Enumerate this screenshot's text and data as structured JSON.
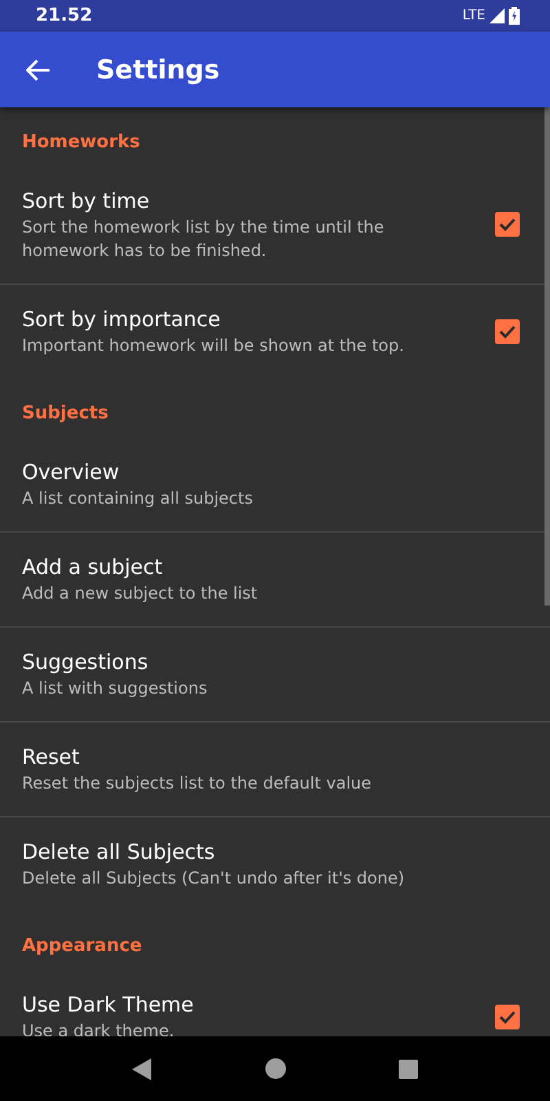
{
  "status_bar": {
    "time": "21.52",
    "network": "LTE"
  },
  "app_bar": {
    "title": "Settings"
  },
  "categories": [
    {
      "title": "Homeworks",
      "items": [
        {
          "kind": "checkbox",
          "title": "Sort by time",
          "summary": "Sort the homework list by the time until the homework has to be finished.",
          "checked": true
        },
        {
          "kind": "checkbox",
          "title": "Sort by importance",
          "summary": "Important homework will be shown at the top.",
          "checked": true
        }
      ]
    },
    {
      "title": "Subjects",
      "items": [
        {
          "kind": "plain",
          "title": "Overview",
          "summary": "A list containing all subjects"
        },
        {
          "kind": "plain",
          "title": "Add a subject",
          "summary": "Add a new subject to the list"
        },
        {
          "kind": "plain",
          "title": "Suggestions",
          "summary": "A list with suggestions"
        },
        {
          "kind": "plain",
          "title": "Reset",
          "summary": "Reset the subjects list to the default value"
        },
        {
          "kind": "plain",
          "title": "Delete all Subjects",
          "summary": "Delete all Subjects (Can't undo after it's done)"
        }
      ]
    },
    {
      "title": "Appearance",
      "items": [
        {
          "kind": "checkbox",
          "title": "Use Dark Theme",
          "summary": "Use a dark theme.",
          "checked": true
        }
      ]
    }
  ]
}
